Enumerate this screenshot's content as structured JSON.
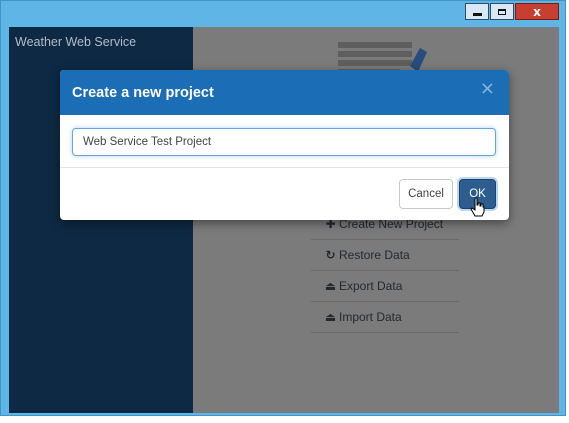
{
  "window": {
    "controls": {
      "minimize_icon": "minimize-icon",
      "maximize_icon": "maximize-icon",
      "close_icon": "close-icon",
      "close_glyph": "x"
    }
  },
  "app": {
    "title": "Weather Web Service"
  },
  "menu": {
    "items": [
      {
        "icon": "plus-icon",
        "glyph": "✚",
        "label": "Create New Project"
      },
      {
        "icon": "refresh-icon",
        "glyph": "↻",
        "label": "Restore Data"
      },
      {
        "icon": "export-icon",
        "glyph": "⏏",
        "label": "Export Data"
      },
      {
        "icon": "import-icon",
        "glyph": "⏏",
        "label": "Import Data"
      }
    ]
  },
  "modal": {
    "title": "Create a new project",
    "close_glyph": "×",
    "input_value": "Web Service Test Project",
    "cancel_label": "Cancel",
    "ok_label": "OK"
  },
  "colors": {
    "window_frame": "#5fb6e6",
    "sidebar": "#0e2944",
    "modal_header": "#1b6db5",
    "ok_button": "#2d5c8f",
    "close_button": "#c83e31"
  }
}
